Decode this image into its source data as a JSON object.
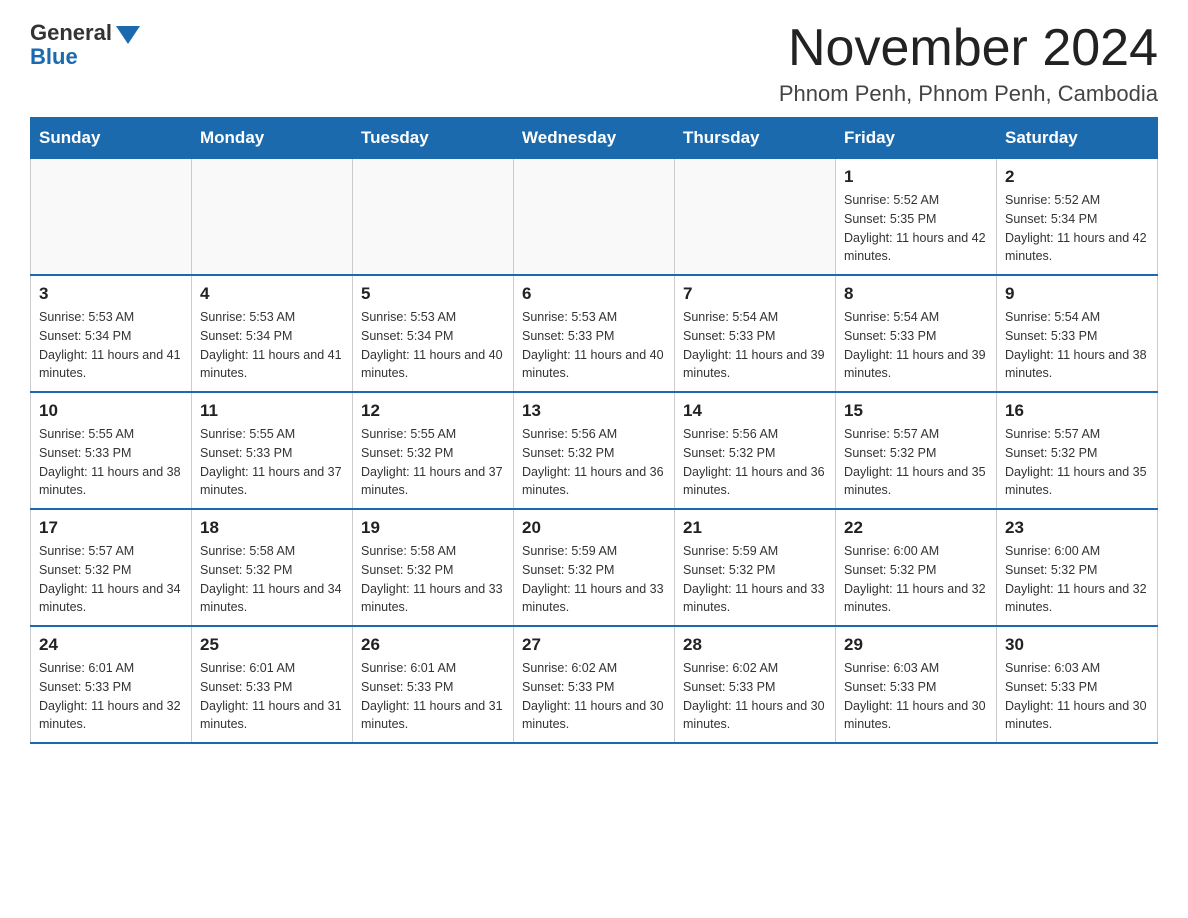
{
  "logo": {
    "general": "General",
    "blue": "Blue"
  },
  "title": "November 2024",
  "subtitle": "Phnom Penh, Phnom Penh, Cambodia",
  "days_of_week": [
    "Sunday",
    "Monday",
    "Tuesday",
    "Wednesday",
    "Thursday",
    "Friday",
    "Saturday"
  ],
  "weeks": [
    [
      {
        "day": "",
        "info": ""
      },
      {
        "day": "",
        "info": ""
      },
      {
        "day": "",
        "info": ""
      },
      {
        "day": "",
        "info": ""
      },
      {
        "day": "",
        "info": ""
      },
      {
        "day": "1",
        "info": "Sunrise: 5:52 AM\nSunset: 5:35 PM\nDaylight: 11 hours and 42 minutes."
      },
      {
        "day": "2",
        "info": "Sunrise: 5:52 AM\nSunset: 5:34 PM\nDaylight: 11 hours and 42 minutes."
      }
    ],
    [
      {
        "day": "3",
        "info": "Sunrise: 5:53 AM\nSunset: 5:34 PM\nDaylight: 11 hours and 41 minutes."
      },
      {
        "day": "4",
        "info": "Sunrise: 5:53 AM\nSunset: 5:34 PM\nDaylight: 11 hours and 41 minutes."
      },
      {
        "day": "5",
        "info": "Sunrise: 5:53 AM\nSunset: 5:34 PM\nDaylight: 11 hours and 40 minutes."
      },
      {
        "day": "6",
        "info": "Sunrise: 5:53 AM\nSunset: 5:33 PM\nDaylight: 11 hours and 40 minutes."
      },
      {
        "day": "7",
        "info": "Sunrise: 5:54 AM\nSunset: 5:33 PM\nDaylight: 11 hours and 39 minutes."
      },
      {
        "day": "8",
        "info": "Sunrise: 5:54 AM\nSunset: 5:33 PM\nDaylight: 11 hours and 39 minutes."
      },
      {
        "day": "9",
        "info": "Sunrise: 5:54 AM\nSunset: 5:33 PM\nDaylight: 11 hours and 38 minutes."
      }
    ],
    [
      {
        "day": "10",
        "info": "Sunrise: 5:55 AM\nSunset: 5:33 PM\nDaylight: 11 hours and 38 minutes."
      },
      {
        "day": "11",
        "info": "Sunrise: 5:55 AM\nSunset: 5:33 PM\nDaylight: 11 hours and 37 minutes."
      },
      {
        "day": "12",
        "info": "Sunrise: 5:55 AM\nSunset: 5:32 PM\nDaylight: 11 hours and 37 minutes."
      },
      {
        "day": "13",
        "info": "Sunrise: 5:56 AM\nSunset: 5:32 PM\nDaylight: 11 hours and 36 minutes."
      },
      {
        "day": "14",
        "info": "Sunrise: 5:56 AM\nSunset: 5:32 PM\nDaylight: 11 hours and 36 minutes."
      },
      {
        "day": "15",
        "info": "Sunrise: 5:57 AM\nSunset: 5:32 PM\nDaylight: 11 hours and 35 minutes."
      },
      {
        "day": "16",
        "info": "Sunrise: 5:57 AM\nSunset: 5:32 PM\nDaylight: 11 hours and 35 minutes."
      }
    ],
    [
      {
        "day": "17",
        "info": "Sunrise: 5:57 AM\nSunset: 5:32 PM\nDaylight: 11 hours and 34 minutes."
      },
      {
        "day": "18",
        "info": "Sunrise: 5:58 AM\nSunset: 5:32 PM\nDaylight: 11 hours and 34 minutes."
      },
      {
        "day": "19",
        "info": "Sunrise: 5:58 AM\nSunset: 5:32 PM\nDaylight: 11 hours and 33 minutes."
      },
      {
        "day": "20",
        "info": "Sunrise: 5:59 AM\nSunset: 5:32 PM\nDaylight: 11 hours and 33 minutes."
      },
      {
        "day": "21",
        "info": "Sunrise: 5:59 AM\nSunset: 5:32 PM\nDaylight: 11 hours and 33 minutes."
      },
      {
        "day": "22",
        "info": "Sunrise: 6:00 AM\nSunset: 5:32 PM\nDaylight: 11 hours and 32 minutes."
      },
      {
        "day": "23",
        "info": "Sunrise: 6:00 AM\nSunset: 5:32 PM\nDaylight: 11 hours and 32 minutes."
      }
    ],
    [
      {
        "day": "24",
        "info": "Sunrise: 6:01 AM\nSunset: 5:33 PM\nDaylight: 11 hours and 32 minutes."
      },
      {
        "day": "25",
        "info": "Sunrise: 6:01 AM\nSunset: 5:33 PM\nDaylight: 11 hours and 31 minutes."
      },
      {
        "day": "26",
        "info": "Sunrise: 6:01 AM\nSunset: 5:33 PM\nDaylight: 11 hours and 31 minutes."
      },
      {
        "day": "27",
        "info": "Sunrise: 6:02 AM\nSunset: 5:33 PM\nDaylight: 11 hours and 30 minutes."
      },
      {
        "day": "28",
        "info": "Sunrise: 6:02 AM\nSunset: 5:33 PM\nDaylight: 11 hours and 30 minutes."
      },
      {
        "day": "29",
        "info": "Sunrise: 6:03 AM\nSunset: 5:33 PM\nDaylight: 11 hours and 30 minutes."
      },
      {
        "day": "30",
        "info": "Sunrise: 6:03 AM\nSunset: 5:33 PM\nDaylight: 11 hours and 30 minutes."
      }
    ]
  ]
}
